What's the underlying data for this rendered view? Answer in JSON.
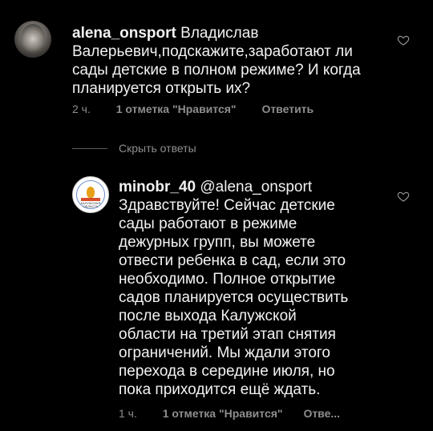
{
  "comment1": {
    "username": "alena_onsport",
    "text_lines": [
      "Владислав",
      "Валерьевич,подскажите,заработают ли",
      "сады детские в полном режиме? И когда",
      "планируется открыть их?"
    ],
    "time": "2 ч.",
    "likes": "1 отметка \"Нравится\"",
    "reply": "Ответить"
  },
  "hide_replies": "Скрыть ответы",
  "comment2": {
    "username": "minobr_40",
    "mention": "@alena_onsport",
    "avatar_text": "КАЛУЖСКАЯ ОБЛАСТЬ",
    "text_lines": [
      "Здравствуйте! Сейчас детские",
      "сады работают в режиме",
      "дежурных групп, вы можете",
      "отвести ребенка в сад, если это",
      "необходимо. Полное открытие",
      "садов планируется осуществить",
      "после выхода Калужской",
      "области на третий этап снятия",
      "ограничений. Мы ждали этого",
      "перехода в середине июля, но",
      "пока приходится ещё ждать."
    ],
    "time": "1 ч.",
    "likes": "1 отметка \"Нравится\"",
    "reply": "Отве..."
  },
  "icons": {
    "like": "heart-outline-icon"
  }
}
